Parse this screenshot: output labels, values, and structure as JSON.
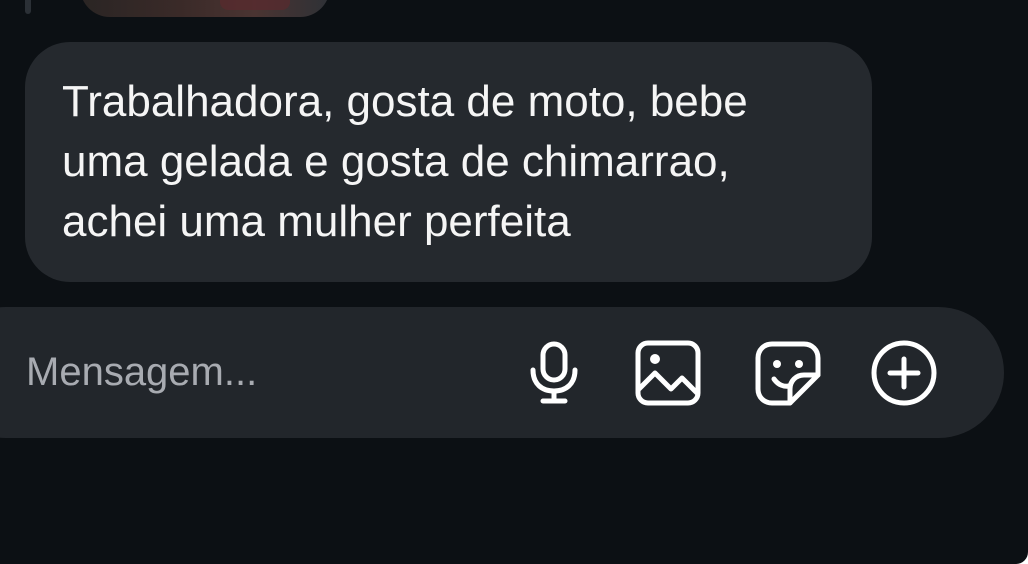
{
  "conversation": {
    "received_message": {
      "lines": [
        "Trabalhadora, gosta de moto, bebe",
        "uma gelada e gosta de chimarrao,",
        "achei uma mulher perfeita"
      ]
    }
  },
  "composer": {
    "placeholder": "Mensagem...",
    "icons": {
      "microphone": "microphone-icon",
      "gallery": "gallery-icon",
      "sticker": "sticker-icon",
      "more": "plus-circle-icon"
    }
  },
  "colors": {
    "background": "#0c1014",
    "bubble": "#25292e",
    "composer": "#22262b",
    "text": "#f5f5f5",
    "placeholder": "#a8abb1"
  }
}
